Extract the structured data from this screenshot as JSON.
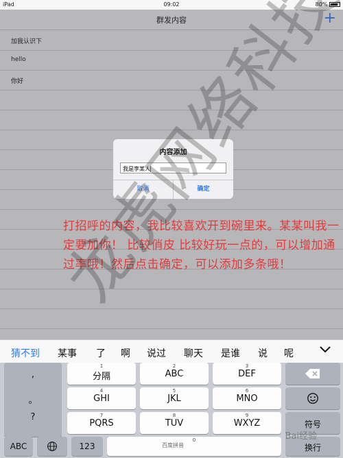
{
  "status": {
    "device": "iPad",
    "time": "09:02",
    "battery": "80%"
  },
  "nav": {
    "title": "群发内容",
    "add_label": "+"
  },
  "list": {
    "items": [
      "加我认识下",
      "hello",
      "你好"
    ]
  },
  "dialog": {
    "title": "内容添加",
    "input_value": "我是李某人",
    "cancel": "取消",
    "ok": "确定"
  },
  "note": "打招呼的内容，我比较喜欢开到碗里来。某某叫我一定要加你！ 比较俏皮 比较好玩一点的，可以增加通过率哦！然后点击确定，可以添加多条哦！",
  "watermark": "龙虎网络科技",
  "baidu": "Bai经验",
  "candidates": [
    "猜不到",
    "某事",
    "了",
    "啊",
    "说过",
    "聊天",
    "是谁",
    "说",
    "呢"
  ],
  "keyboard": {
    "punct": [
      ",",
      "。",
      "?"
    ],
    "r1": [
      {
        "label": "分隔",
        "num": "1"
      },
      {
        "label": "ABC",
        "num": "2"
      },
      {
        "label": "DEF",
        "num": "3"
      }
    ],
    "r2": [
      {
        "label": "GHI",
        "num": "4"
      },
      {
        "label": "JKL",
        "num": "5"
      },
      {
        "label": "MNO",
        "num": "6"
      }
    ],
    "r3": [
      {
        "label": "PQRS",
        "num": "7"
      },
      {
        "label": "TUV",
        "num": "8"
      },
      {
        "label": "WXYZ",
        "num": "9"
      }
    ],
    "symbol": "符号",
    "abc": "ABC",
    "num123": "123",
    "zero": "0",
    "space_hint": "百度拼音",
    "enter": "换行"
  },
  "colors": {
    "accent": "#2a7bf5",
    "note": "#e33a3a"
  }
}
